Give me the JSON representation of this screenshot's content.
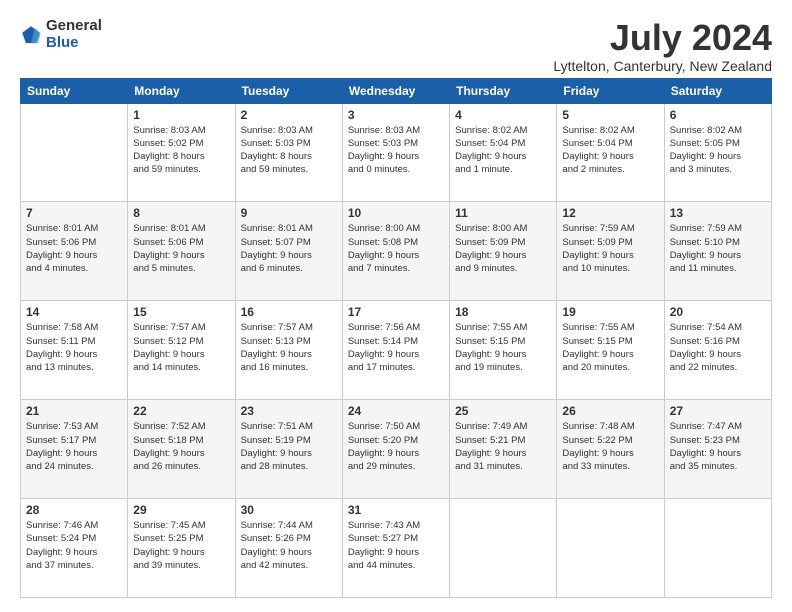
{
  "header": {
    "logo_line1": "General",
    "logo_line2": "Blue",
    "month": "July 2024",
    "location": "Lyttelton, Canterbury, New Zealand"
  },
  "weekdays": [
    "Sunday",
    "Monday",
    "Tuesday",
    "Wednesday",
    "Thursday",
    "Friday",
    "Saturday"
  ],
  "weeks": [
    [
      {
        "day": "",
        "info": ""
      },
      {
        "day": "1",
        "info": "Sunrise: 8:03 AM\nSunset: 5:02 PM\nDaylight: 8 hours\nand 59 minutes."
      },
      {
        "day": "2",
        "info": "Sunrise: 8:03 AM\nSunset: 5:03 PM\nDaylight: 8 hours\nand 59 minutes."
      },
      {
        "day": "3",
        "info": "Sunrise: 8:03 AM\nSunset: 5:03 PM\nDaylight: 9 hours\nand 0 minutes."
      },
      {
        "day": "4",
        "info": "Sunrise: 8:02 AM\nSunset: 5:04 PM\nDaylight: 9 hours\nand 1 minute."
      },
      {
        "day": "5",
        "info": "Sunrise: 8:02 AM\nSunset: 5:04 PM\nDaylight: 9 hours\nand 2 minutes."
      },
      {
        "day": "6",
        "info": "Sunrise: 8:02 AM\nSunset: 5:05 PM\nDaylight: 9 hours\nand 3 minutes."
      }
    ],
    [
      {
        "day": "7",
        "info": "Sunrise: 8:01 AM\nSunset: 5:06 PM\nDaylight: 9 hours\nand 4 minutes."
      },
      {
        "day": "8",
        "info": "Sunrise: 8:01 AM\nSunset: 5:06 PM\nDaylight: 9 hours\nand 5 minutes."
      },
      {
        "day": "9",
        "info": "Sunrise: 8:01 AM\nSunset: 5:07 PM\nDaylight: 9 hours\nand 6 minutes."
      },
      {
        "day": "10",
        "info": "Sunrise: 8:00 AM\nSunset: 5:08 PM\nDaylight: 9 hours\nand 7 minutes."
      },
      {
        "day": "11",
        "info": "Sunrise: 8:00 AM\nSunset: 5:09 PM\nDaylight: 9 hours\nand 9 minutes."
      },
      {
        "day": "12",
        "info": "Sunrise: 7:59 AM\nSunset: 5:09 PM\nDaylight: 9 hours\nand 10 minutes."
      },
      {
        "day": "13",
        "info": "Sunrise: 7:59 AM\nSunset: 5:10 PM\nDaylight: 9 hours\nand 11 minutes."
      }
    ],
    [
      {
        "day": "14",
        "info": "Sunrise: 7:58 AM\nSunset: 5:11 PM\nDaylight: 9 hours\nand 13 minutes."
      },
      {
        "day": "15",
        "info": "Sunrise: 7:57 AM\nSunset: 5:12 PM\nDaylight: 9 hours\nand 14 minutes."
      },
      {
        "day": "16",
        "info": "Sunrise: 7:57 AM\nSunset: 5:13 PM\nDaylight: 9 hours\nand 16 minutes."
      },
      {
        "day": "17",
        "info": "Sunrise: 7:56 AM\nSunset: 5:14 PM\nDaylight: 9 hours\nand 17 minutes."
      },
      {
        "day": "18",
        "info": "Sunrise: 7:55 AM\nSunset: 5:15 PM\nDaylight: 9 hours\nand 19 minutes."
      },
      {
        "day": "19",
        "info": "Sunrise: 7:55 AM\nSunset: 5:15 PM\nDaylight: 9 hours\nand 20 minutes."
      },
      {
        "day": "20",
        "info": "Sunrise: 7:54 AM\nSunset: 5:16 PM\nDaylight: 9 hours\nand 22 minutes."
      }
    ],
    [
      {
        "day": "21",
        "info": "Sunrise: 7:53 AM\nSunset: 5:17 PM\nDaylight: 9 hours\nand 24 minutes."
      },
      {
        "day": "22",
        "info": "Sunrise: 7:52 AM\nSunset: 5:18 PM\nDaylight: 9 hours\nand 26 minutes."
      },
      {
        "day": "23",
        "info": "Sunrise: 7:51 AM\nSunset: 5:19 PM\nDaylight: 9 hours\nand 28 minutes."
      },
      {
        "day": "24",
        "info": "Sunrise: 7:50 AM\nSunset: 5:20 PM\nDaylight: 9 hours\nand 29 minutes."
      },
      {
        "day": "25",
        "info": "Sunrise: 7:49 AM\nSunset: 5:21 PM\nDaylight: 9 hours\nand 31 minutes."
      },
      {
        "day": "26",
        "info": "Sunrise: 7:48 AM\nSunset: 5:22 PM\nDaylight: 9 hours\nand 33 minutes."
      },
      {
        "day": "27",
        "info": "Sunrise: 7:47 AM\nSunset: 5:23 PM\nDaylight: 9 hours\nand 35 minutes."
      }
    ],
    [
      {
        "day": "28",
        "info": "Sunrise: 7:46 AM\nSunset: 5:24 PM\nDaylight: 9 hours\nand 37 minutes."
      },
      {
        "day": "29",
        "info": "Sunrise: 7:45 AM\nSunset: 5:25 PM\nDaylight: 9 hours\nand 39 minutes."
      },
      {
        "day": "30",
        "info": "Sunrise: 7:44 AM\nSunset: 5:26 PM\nDaylight: 9 hours\nand 42 minutes."
      },
      {
        "day": "31",
        "info": "Sunrise: 7:43 AM\nSunset: 5:27 PM\nDaylight: 9 hours\nand 44 minutes."
      },
      {
        "day": "",
        "info": ""
      },
      {
        "day": "",
        "info": ""
      },
      {
        "day": "",
        "info": ""
      }
    ]
  ]
}
